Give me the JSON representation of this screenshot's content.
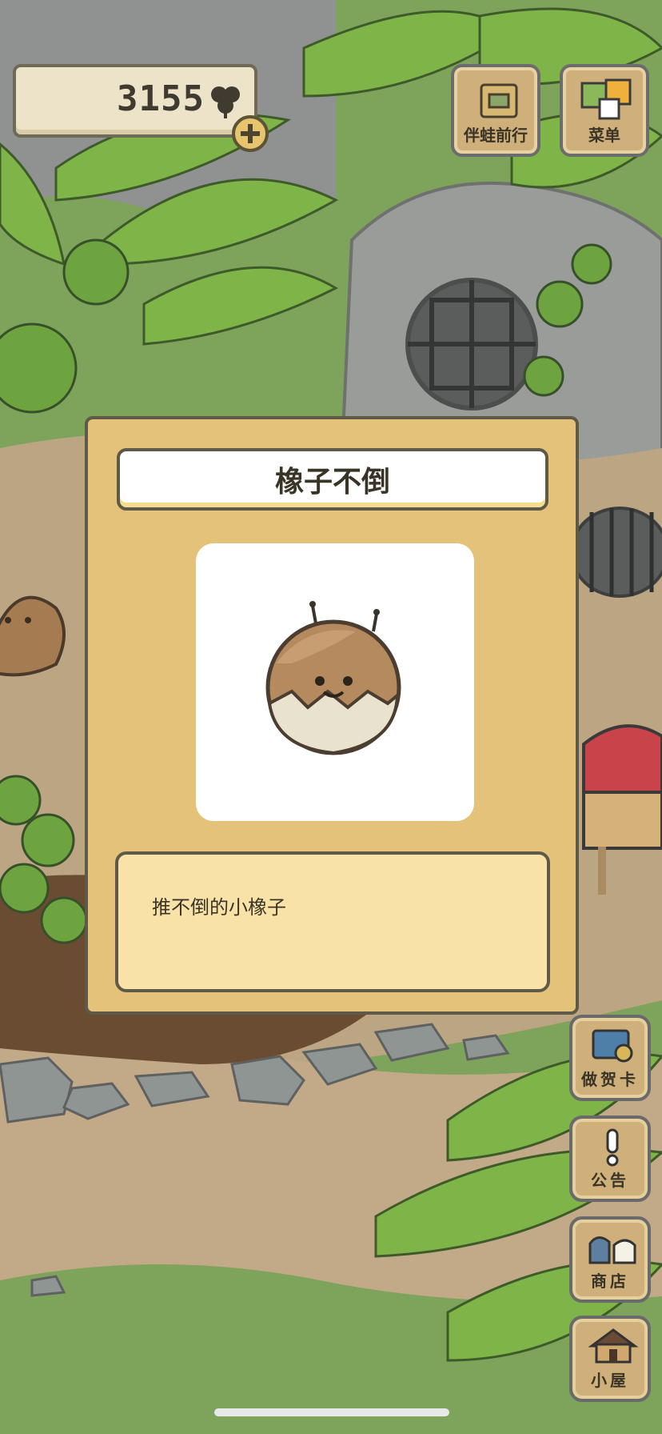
{
  "currency": {
    "count": "3155",
    "icon": "clover-icon"
  },
  "top_buttons": [
    {
      "label": "伴蛙前行",
      "icon": "frog-travel-icon"
    },
    {
      "label": "菜单",
      "icon": "menu-icon"
    }
  ],
  "side_buttons": [
    {
      "label": "做贺卡",
      "icon": "card-icon"
    },
    {
      "label": "公告",
      "icon": "notice-icon"
    },
    {
      "label": "商店",
      "icon": "shop-icon"
    },
    {
      "label": "小屋",
      "icon": "house-icon"
    }
  ],
  "item_popup": {
    "title": "橡子不倒",
    "description": "推不倒的小橡子",
    "item_icon": "acorn-roly-poly-icon"
  },
  "colors": {
    "panel": "#e5c27a",
    "description_bg": "#f9e2a7",
    "border": "#5e5a47",
    "leaf_green": "#7fb548"
  }
}
